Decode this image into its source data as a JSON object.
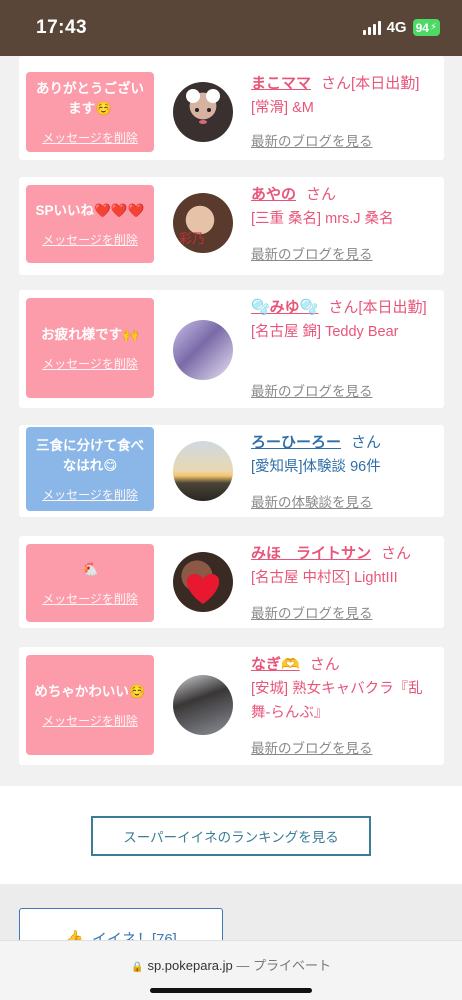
{
  "status": {
    "time": "17:43",
    "network": "4G",
    "battery": "94"
  },
  "items": [
    {
      "bubble_color": "pink",
      "message": "ありがとうございます☺️",
      "delete_label": "メッセージを削除",
      "name": "まこママ",
      "san": "さん",
      "tag": "[本日出勤]",
      "shop": "[常滑] &M",
      "link": "最新のブログを見る"
    },
    {
      "bubble_color": "pink",
      "message": "SPいいね❤️❤️❤️",
      "delete_label": "メッセージを削除",
      "name": "あやの",
      "san": "さん",
      "tag": "",
      "shop": "[三重 桑名] mrs.J 桑名",
      "link": "最新のブログを見る"
    },
    {
      "bubble_color": "pink",
      "message": "お疲れ様です🙌",
      "delete_label": "メッセージを削除",
      "name": "🫧みゆ🫧",
      "san": "さん",
      "tag": "[本日出勤]",
      "shop": "[名古屋 錦] Teddy Bear",
      "link": "最新のブログを見る"
    },
    {
      "bubble_color": "blue",
      "message": "三食に分けて食べなはれ😋",
      "delete_label": "メッセージを削除",
      "name": "ろーひーろー",
      "san": "さん",
      "tag": "",
      "shop": "[愛知県]体験談 96件",
      "link": "最新の体験談を見る"
    },
    {
      "bubble_color": "pink",
      "message": "🐔",
      "delete_label": "メッセージを削除",
      "name": "みほ　ライトサン",
      "san": "さん",
      "tag": "",
      "shop": "[名古屋 中村区] LightIII",
      "link": "最新のブログを見る"
    },
    {
      "bubble_color": "pink",
      "message": "めちゃかわいい☺️",
      "delete_label": "メッセージを削除",
      "name": "なぎ🫶",
      "san": "さん",
      "tag": "",
      "shop": "[安城] 熟女キャバクラ『乱舞-らんぶ』",
      "link": "最新のブログを見る"
    }
  ],
  "ranking_button": "スーパーイイネのランキングを見る",
  "iine_button": "イイネ！[76]",
  "safari": {
    "domain": "sp.pokepara.jp",
    "suffix": "— プライベート"
  },
  "colors": {
    "pink": "#fc9caa",
    "blue": "#8ab7e8",
    "name_pink": "#e8557a",
    "name_blue": "#2e6ea8",
    "status_bg": "#5a4638"
  }
}
